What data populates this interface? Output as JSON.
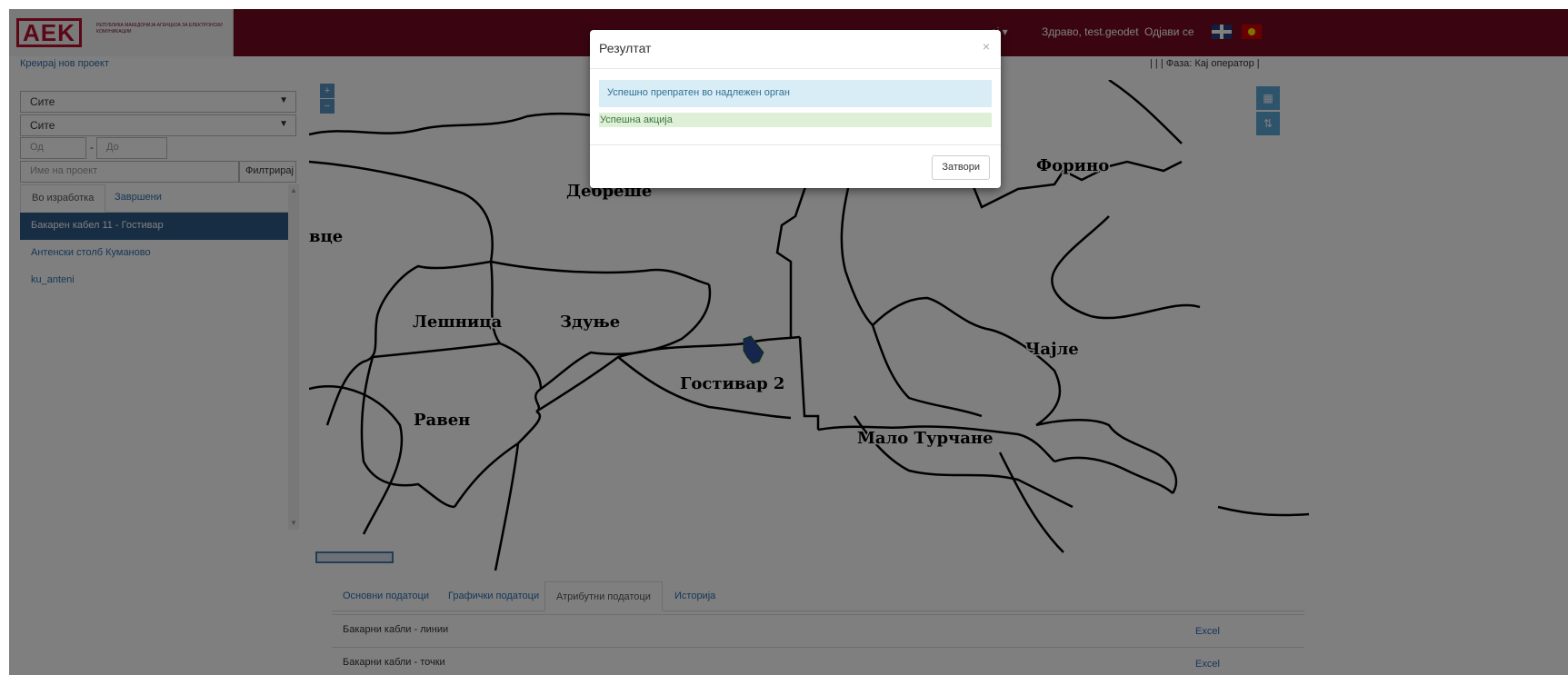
{
  "header": {
    "logo_text": "AEK",
    "logo_sub": "РЕПУБЛИКА МАКЕДОНИЈА АГЕНЦИЈА ЗА ЕЛЕКТРОНСКИ КОМУНИКАЦИИ",
    "partial_menu": "ај ▾",
    "greeting": "Здраво, test.geodet",
    "logout": "Одјави се"
  },
  "toolbar": {
    "create_project": "Креирај нов проект",
    "phase": "| | | Фаза: Кај оператор |"
  },
  "filters": {
    "select1": "Сите",
    "select2": "Сите",
    "from_placeholder": "Од",
    "to_placeholder": "До",
    "dash": "-",
    "name_placeholder": "Име на проект",
    "filter_button": "Филтрирај"
  },
  "project_tabs": [
    "Во изработка",
    "Завршени"
  ],
  "projects": [
    "Бакарен кабел 11 - Гостивар",
    "Антенски столб Куманово",
    "ku_anteni"
  ],
  "map": {
    "labels": [
      "Форино",
      "Дебреше",
      "вце",
      "Лешница",
      "Здуње",
      "Чајле",
      "Гостивар 2",
      "Равен",
      "Мало Турчане"
    ],
    "zoom_in": "+",
    "zoom_out": "−"
  },
  "bottom_tabs": [
    "Основни податоци",
    "Графички податоци",
    "Атрибутни податоци",
    "Историја"
  ],
  "rows": [
    {
      "label": "Бакарни кабли - линии",
      "action": "Excel"
    },
    {
      "label": "Бакарни кабли - точки",
      "action": "Excel"
    }
  ],
  "modal": {
    "title": "Резултат",
    "close_symbol": "×",
    "info": "Успешно препратен во надлежен орган",
    "success": "Успешна акција",
    "close_button": "Затвори"
  },
  "colors": {
    "header_bg": "#740b22",
    "active_project": "#2c5b86",
    "link": "#2a6fb0"
  }
}
